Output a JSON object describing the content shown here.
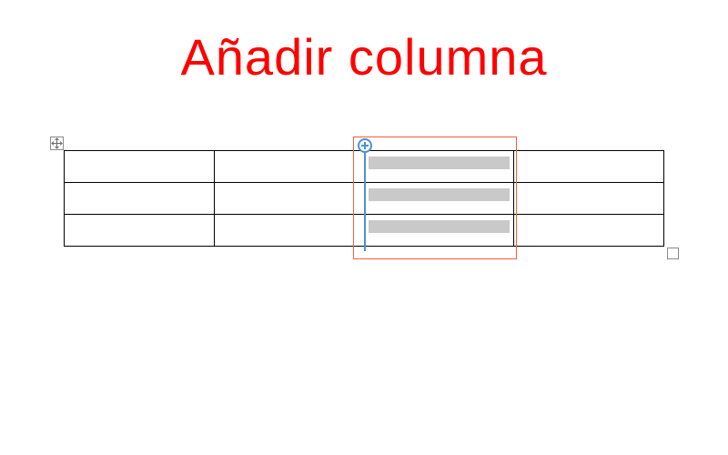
{
  "title": "Añadir columna",
  "table": {
    "rows": 3,
    "cols": 4,
    "highlighted_column_index": 2,
    "cells": [
      [
        "",
        "",
        "",
        ""
      ],
      [
        "",
        "",
        "",
        ""
      ],
      [
        "",
        "",
        "",
        ""
      ]
    ]
  },
  "icons": {
    "move_handle": "move-cross",
    "add_column": "plus-circle",
    "resize_handle": "resize-square"
  },
  "colors": {
    "title": "#ff0000",
    "highlight_border": "#ff5a3c",
    "insert_guide": "#4a90d9",
    "cell_shade": "#c9c9c9"
  }
}
